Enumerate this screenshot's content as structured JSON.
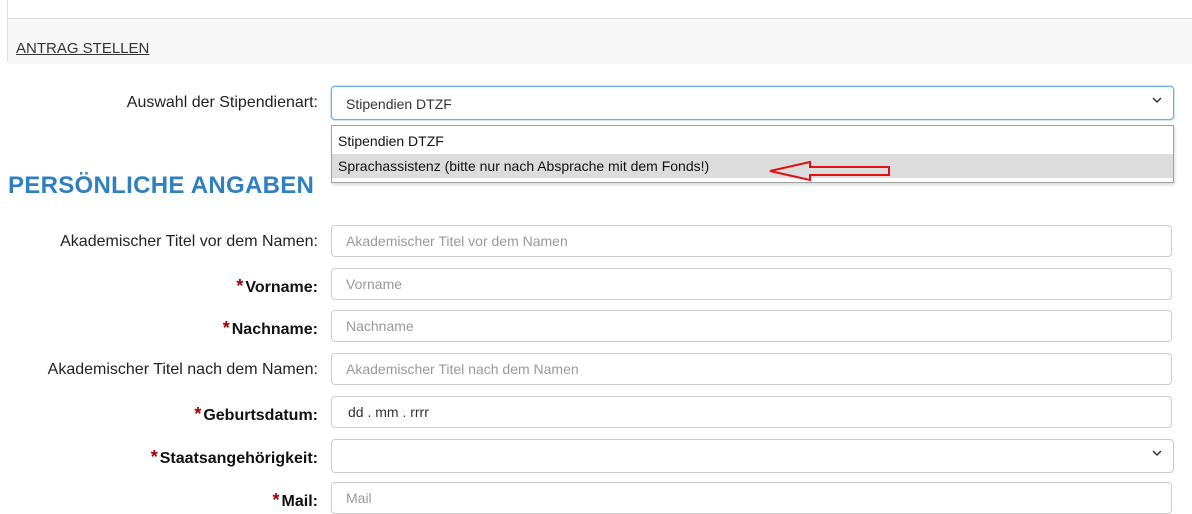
{
  "panel": {
    "link_label": "ANTRAG STELLEN"
  },
  "stipend": {
    "label": "Auswahl der Stipendienart:",
    "selected": "Stipendien DTZF",
    "options": [
      "Stipendien DTZF",
      "Sprachassistenz (bitte nur nach Absprache mit dem Fonds!)"
    ]
  },
  "section": {
    "heading": "PERSÖNLICHE ANGABEN"
  },
  "form": {
    "titel_vor": {
      "label": "Akademischer Titel vor dem Namen:",
      "placeholder": "Akademischer Titel vor dem Namen"
    },
    "vorname": {
      "label": "Vorname:",
      "placeholder": "Vorname"
    },
    "nachname": {
      "label": "Nachname:",
      "placeholder": "Nachname"
    },
    "titel_nach": {
      "label": "Akademischer Titel nach dem Namen:",
      "placeholder": "Akademischer Titel nach dem Namen"
    },
    "geburtsdatum": {
      "label": "Geburtsdatum:",
      "value": "dd . mm . rrrr"
    },
    "staat": {
      "label": "Staatsangehörigkeit:",
      "value": ""
    },
    "mail": {
      "label": "Mail:",
      "placeholder": "Mail"
    }
  },
  "required_marker": "*",
  "colors": {
    "heading": "#2f7fc1",
    "required": "#a00000",
    "annotation_arrow": "#e01010"
  },
  "icons": {
    "select_chevron": "chevron-down-icon",
    "annotation": "red-arrow-annotation"
  }
}
